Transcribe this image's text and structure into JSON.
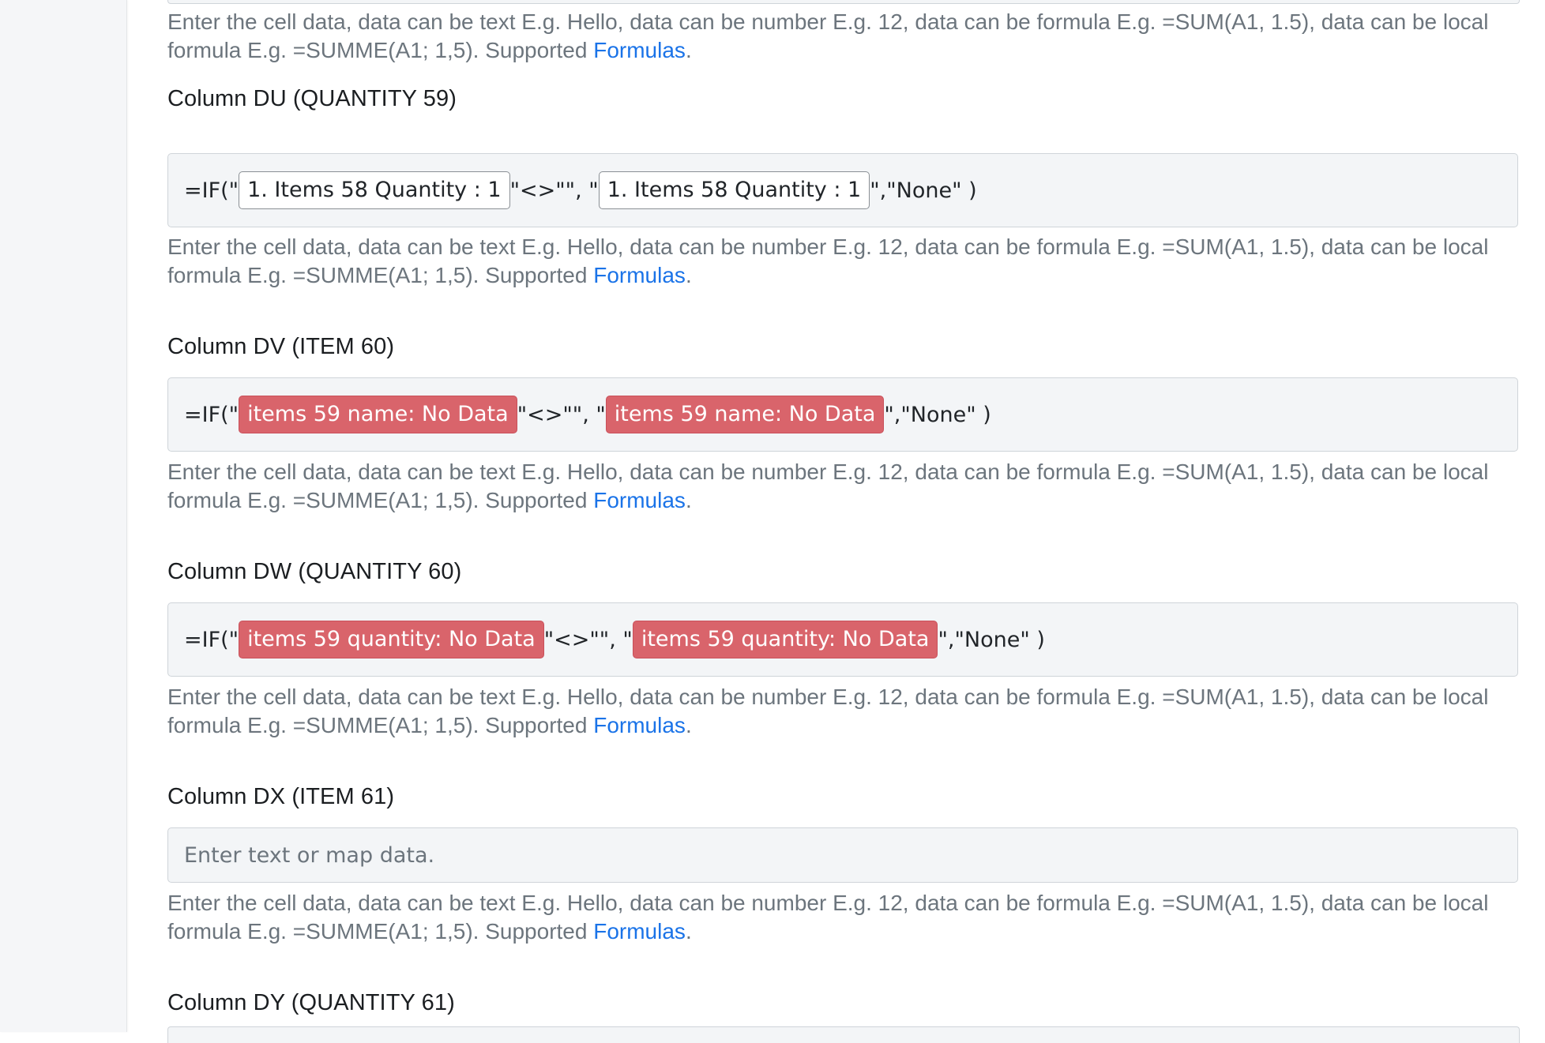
{
  "help": {
    "before_link": "Enter the cell data, data can be text E.g. Hello, data can be number E.g. 12, data can be formula E.g. =SUM(A1, 1.5), data can be local formula E.g. =SUMME(A1; 1,5). Supported ",
    "link": "Formulas",
    "after_link": "."
  },
  "formula": {
    "prefix": "=IF(\"",
    "middle": "\"<>\"\", \"",
    "suffix": "\",\"None\" )"
  },
  "fields": {
    "du": {
      "label": "Column DU (QUANTITY 59)",
      "chip1": "1. Items 58 Quantity : 1",
      "chip2": "1. Items 58 Quantity : 1"
    },
    "dv": {
      "label": "Column DV (ITEM 60)",
      "chip1": "items 59 name: No Data",
      "chip2": "items 59 name: No Data"
    },
    "dw": {
      "label": "Column DW (QUANTITY 60)",
      "chip1": "items 59 quantity: No Data",
      "chip2": "items 59 quantity: No Data"
    },
    "dx": {
      "label": "Column DX (ITEM 61)",
      "placeholder": "Enter text or map data."
    },
    "dy": {
      "label": "Column DY (QUANTITY 61)"
    }
  },
  "colors": {
    "link": "#1a73e8",
    "no_data_chip": "#d9646b",
    "help_text": "#6c757d"
  }
}
